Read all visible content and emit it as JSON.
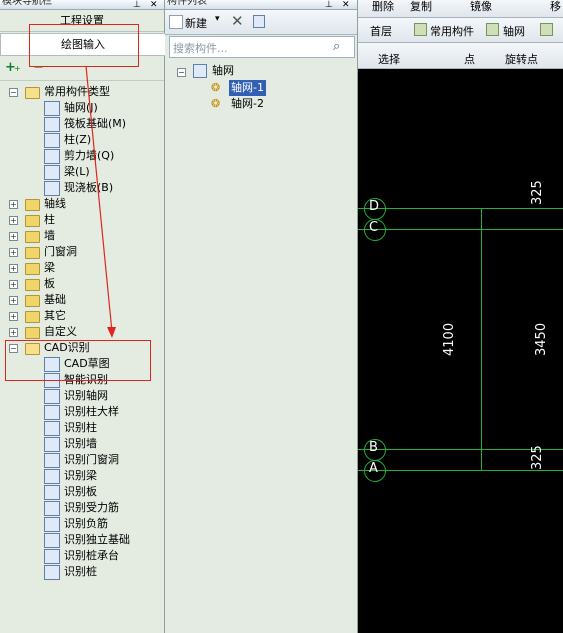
{
  "left_panel": {
    "title": "模块导航栏",
    "nav_buttons": [
      "工程设置",
      "绘图输入"
    ],
    "tree": [
      {
        "label": "常用构件类型",
        "level": 0,
        "expanded": true
      },
      {
        "label": "轴网(J)",
        "level": 1
      },
      {
        "label": "筏板基础(M)",
        "level": 1
      },
      {
        "label": "柱(Z)",
        "level": 1
      },
      {
        "label": "剪力墙(Q)",
        "level": 1
      },
      {
        "label": "梁(L)",
        "level": 1
      },
      {
        "label": "现浇板(B)",
        "level": 1
      },
      {
        "label": "轴线",
        "level": 0
      },
      {
        "label": "柱",
        "level": 0
      },
      {
        "label": "墙",
        "level": 0
      },
      {
        "label": "门窗洞",
        "level": 0
      },
      {
        "label": "梁",
        "level": 0
      },
      {
        "label": "板",
        "level": 0
      },
      {
        "label": "基础",
        "level": 0
      },
      {
        "label": "其它",
        "level": 0
      },
      {
        "label": "自定义",
        "level": 0
      },
      {
        "label": "CAD识别",
        "level": 0,
        "expanded": true
      },
      {
        "label": "CAD草图",
        "level": 1
      },
      {
        "label": "智能识别",
        "level": 1
      },
      {
        "label": "识别轴网",
        "level": 1
      },
      {
        "label": "识别柱大样",
        "level": 1
      },
      {
        "label": "识别柱",
        "level": 1
      },
      {
        "label": "识别墙",
        "level": 1
      },
      {
        "label": "识别门窗洞",
        "level": 1
      },
      {
        "label": "识别梁",
        "level": 1
      },
      {
        "label": "识别板",
        "level": 1
      },
      {
        "label": "识别受力筋",
        "level": 1
      },
      {
        "label": "识别负筋",
        "level": 1
      },
      {
        "label": "识别独立基础",
        "level": 1
      },
      {
        "label": "识别桩承台",
        "level": 1
      },
      {
        "label": "识别桩",
        "level": 1
      }
    ]
  },
  "mid_panel": {
    "title": "构件列表",
    "new_label": "新建",
    "search_placeholder": "搜索构件...",
    "tree_root": "轴网",
    "items": [
      "轴网-1",
      "轴网-2"
    ]
  },
  "right_panel": {
    "toolbar1": [
      "删除",
      "复制",
      "镜像",
      "移"
    ],
    "toolbar2": {
      "floor": "首层",
      "category": "常用构件",
      "type": "轴网"
    },
    "toolbar3": {
      "select": "选择",
      "point": "点",
      "rotate_point": "旋转点"
    },
    "axes": [
      "D",
      "C",
      "B",
      "A"
    ],
    "dims": {
      "top": "325",
      "mid_left": "4100",
      "mid_right": "3450",
      "bottom": "325"
    }
  }
}
